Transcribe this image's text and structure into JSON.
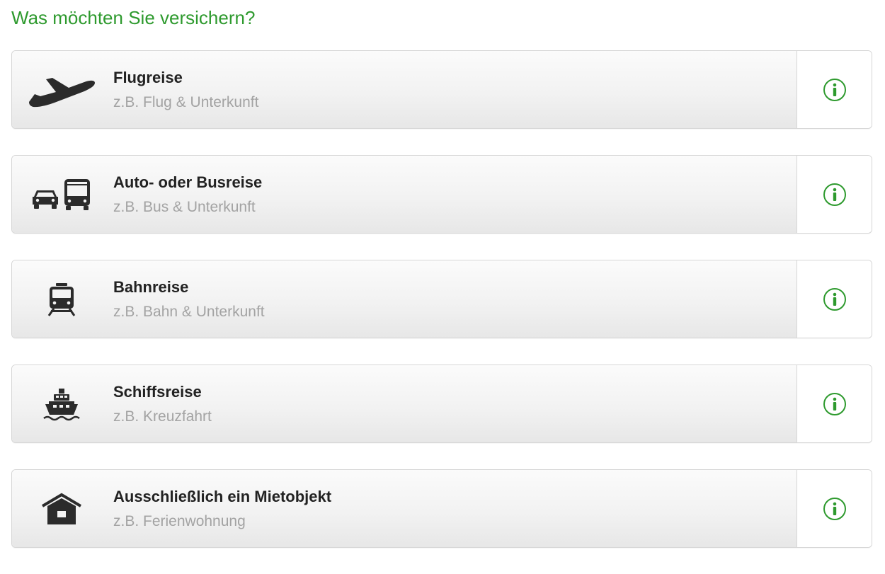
{
  "page": {
    "title": "Was möchten Sie versichern?"
  },
  "colors": {
    "accent_green": "#2e9a2e",
    "title_text": "#222222",
    "subtitle_text": "#a3a3a3",
    "card_border": "#d6d6d6"
  },
  "options": [
    {
      "title": "Flugreise",
      "subtitle": "z.B. Flug & Unterkunft",
      "icon": "airplane-icon",
      "info_icon": "info-icon"
    },
    {
      "title": "Auto- oder Busreise",
      "subtitle": "z.B. Bus & Unterkunft",
      "icon": "car-bus-icon",
      "info_icon": "info-icon"
    },
    {
      "title": "Bahnreise",
      "subtitle": "z.B. Bahn & Unterkunft",
      "icon": "train-icon",
      "info_icon": "info-icon"
    },
    {
      "title": "Schiffsreise",
      "subtitle": "z.B. Kreuzfahrt",
      "icon": "ship-icon",
      "info_icon": "info-icon"
    },
    {
      "title": "Ausschließlich ein Mietobjekt",
      "subtitle": "z.B. Ferienwohnung",
      "icon": "house-icon",
      "info_icon": "info-icon"
    }
  ]
}
